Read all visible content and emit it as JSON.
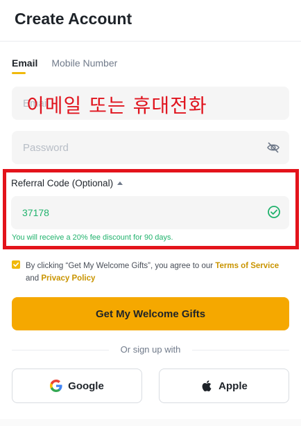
{
  "header": {
    "title": "Create Account"
  },
  "tabs": [
    {
      "label": "Email",
      "active": true
    },
    {
      "label": "Mobile Number",
      "active": false
    }
  ],
  "email": {
    "placeholder": "Email",
    "value": ""
  },
  "annotation": {
    "korean_text": "이메일 또는 휴대전화",
    "color": "#e0141e"
  },
  "password": {
    "placeholder": "Password",
    "value": ""
  },
  "referral": {
    "label": "Referral Code (Optional)",
    "value": "37178",
    "note": "You will receive a 20% fee discount for 90 days."
  },
  "agreement": {
    "checked": true,
    "text_before": "By clicking “Get My Welcome Gifts”, you agree to our ",
    "terms_link": "Terms of Service",
    "text_and": " and ",
    "privacy_link": "Privacy Policy"
  },
  "primary_button": {
    "label": "Get My Welcome Gifts"
  },
  "divider": {
    "text": "Or sign up with"
  },
  "social": {
    "google_label": "Google",
    "apple_label": "Apple"
  },
  "colors": {
    "accent": "#f5a800",
    "success": "#20b26c",
    "highlight_box": "#e3131b",
    "link": "#c99400"
  },
  "icons": [
    "eye-slash-icon",
    "caret-up-icon",
    "check-circle-icon",
    "checkbox-check-icon",
    "google-icon",
    "apple-icon"
  ]
}
